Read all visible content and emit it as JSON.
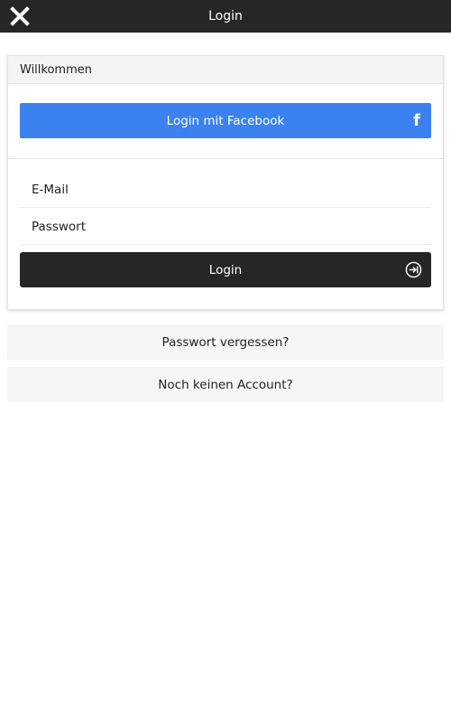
{
  "header": {
    "title": "Login",
    "close_icon": "close-icon"
  },
  "card": {
    "heading": "Willkommen",
    "facebook_button": {
      "label": "Login mit Facebook",
      "icon": "facebook-icon",
      "icon_glyph": "f",
      "color": "#3b82f0"
    },
    "email_field": {
      "placeholder": "E-Mail",
      "value": ""
    },
    "password_field": {
      "placeholder": "Passwort",
      "value": ""
    },
    "login_button": {
      "label": "Login",
      "icon": "sign-in-icon",
      "color": "#262626"
    }
  },
  "links": {
    "forgot_password": "Passwort vergessen?",
    "no_account": "Noch keinen Account?"
  }
}
